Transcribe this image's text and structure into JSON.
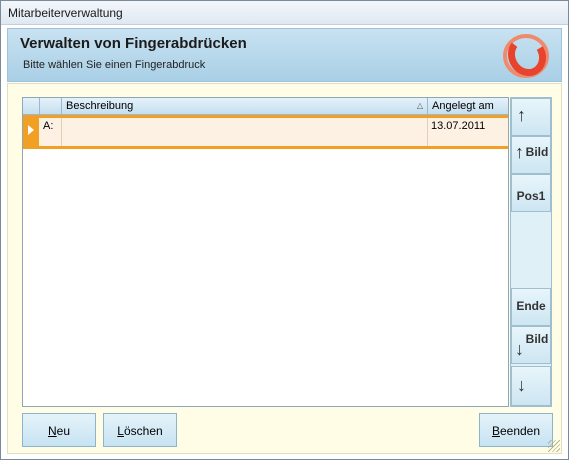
{
  "window": {
    "title": "Mitarbeiterverwaltung"
  },
  "header": {
    "title": "Verwalten von Fingerabdrücken",
    "subtitle": "Bitte wählen Sie einen Fingerabdruck"
  },
  "grid": {
    "columns": [
      "",
      "Beschreibung",
      "Angelegt am"
    ],
    "sort_indicator": "△",
    "rows": [
      {
        "finger": "A:",
        "beschreibung": "",
        "angelegt_am": "13.07.2011"
      }
    ]
  },
  "nav": {
    "up_label": "",
    "page_up_label": "Bild",
    "home_label": "Pos1",
    "end_label": "Ende",
    "page_down_label": "Bild",
    "down_label": ""
  },
  "buttons": {
    "new_mnemonic": "N",
    "new_rest": "eu",
    "delete_mnemonic": "L",
    "delete_rest": "öschen",
    "exit_mnemonic": "B",
    "exit_rest": "eenden"
  },
  "colors": {
    "accent": "#f2a024",
    "header": "#b8d8ec",
    "logo": "#e8432c"
  }
}
